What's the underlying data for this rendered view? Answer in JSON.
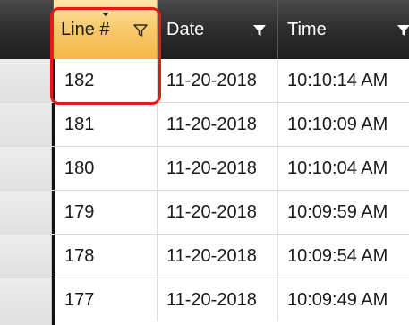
{
  "grid": {
    "columns": [
      {
        "key": "line",
        "label": "Line #"
      },
      {
        "key": "date",
        "label": "Date"
      },
      {
        "key": "time",
        "label": "Time"
      }
    ],
    "rows": [
      {
        "line": "182",
        "date": "11-20-2018",
        "time": "10:10:14 AM"
      },
      {
        "line": "181",
        "date": "11-20-2018",
        "time": "10:10:09 AM"
      },
      {
        "line": "180",
        "date": "11-20-2018",
        "time": "10:10:04 AM"
      },
      {
        "line": "179",
        "date": "11-20-2018",
        "time": "10:09:59 AM"
      },
      {
        "line": "178",
        "date": "11-20-2018",
        "time": "10:09:54 AM"
      },
      {
        "line": "177",
        "date": "11-20-2018",
        "time": "10:09:49 AM"
      }
    ],
    "sorted_column": "line",
    "sort_direction": "descending"
  },
  "colors": {
    "header_dark": "#2b2b2b",
    "header_active": "#f8c86a",
    "highlight": "#e51919"
  },
  "icons": {
    "filter": "filter-funnel-icon",
    "sort": "sort-descending-icon"
  }
}
